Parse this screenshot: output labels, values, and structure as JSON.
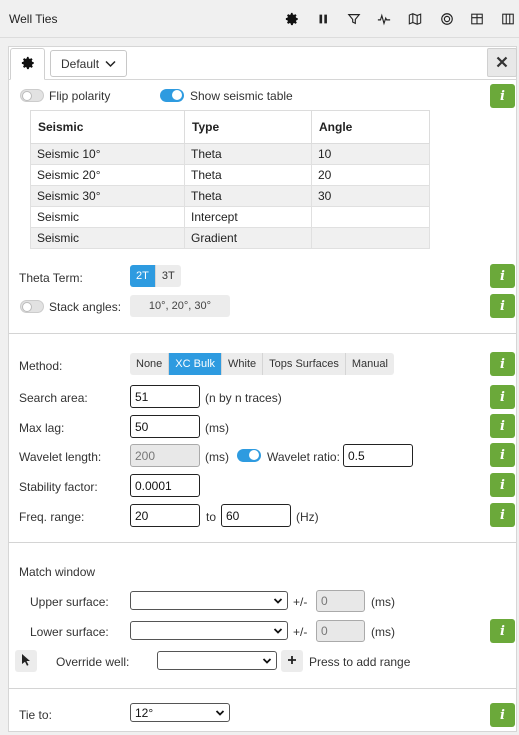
{
  "window": {
    "title": "Well Ties"
  },
  "toolbar_icons": [
    "gear-icon",
    "pause-icon",
    "filter-icon",
    "waveform-icon",
    "map-icon",
    "target-icon",
    "grid-icon",
    "columns-icon"
  ],
  "tabs": {
    "preset_label": "Default"
  },
  "polarity": {
    "label": "Flip polarity",
    "on": false
  },
  "seismic_table_toggle": {
    "label": "Show seismic table",
    "on": true
  },
  "seismic_table": {
    "headers": [
      "Seismic",
      "Type",
      "Angle"
    ],
    "rows": [
      [
        "Seismic 10°",
        "Theta",
        "10"
      ],
      [
        "Seismic 20°",
        "Theta",
        "20"
      ],
      [
        "Seismic 30°",
        "Theta",
        "30"
      ],
      [
        "Seismic",
        "Intercept",
        ""
      ],
      [
        "Seismic",
        "Gradient",
        ""
      ]
    ]
  },
  "theta_term": {
    "label": "Theta Term:",
    "options": [
      "2T",
      "3T"
    ],
    "selected": "2T"
  },
  "stack_angles": {
    "label": "Stack angles:",
    "on": false,
    "value": "10°, 20°, 30°"
  },
  "method": {
    "label": "Method:",
    "options": [
      "None",
      "XC Bulk",
      "White",
      "Tops Surfaces",
      "Manual"
    ],
    "selected": "XC Bulk"
  },
  "search_area": {
    "label": "Search area:",
    "value": "51",
    "unit": "(n by n traces)"
  },
  "max_lag": {
    "label": "Max lag:",
    "value": "50",
    "unit": "(ms)"
  },
  "wavelet_length": {
    "label": "Wavelet length:",
    "value": "200",
    "unit": "(ms)"
  },
  "wavelet_ratio": {
    "label": "Wavelet ratio:",
    "on": true,
    "value": "0.5"
  },
  "stability_factor": {
    "label": "Stability factor:",
    "value": "0.0001"
  },
  "freq_range": {
    "label": "Freq. range:",
    "from": "20",
    "to_label": "to",
    "to": "60",
    "unit": "(Hz)"
  },
  "match_window": {
    "title": "Match window",
    "upper": {
      "label": "Upper surface:",
      "value": "",
      "pm": "+/-",
      "offset": "0",
      "unit": "(ms)"
    },
    "lower": {
      "label": "Lower surface:",
      "value": "",
      "pm": "+/-",
      "offset": "0",
      "unit": "(ms)"
    },
    "override": {
      "label": "Override well:",
      "value": "",
      "add_hint": "Press to add range"
    }
  },
  "tie_to": {
    "label": "Tie to:",
    "value": "12°"
  },
  "colors": {
    "accent": "#2e9be0",
    "info": "#6ba93a"
  }
}
